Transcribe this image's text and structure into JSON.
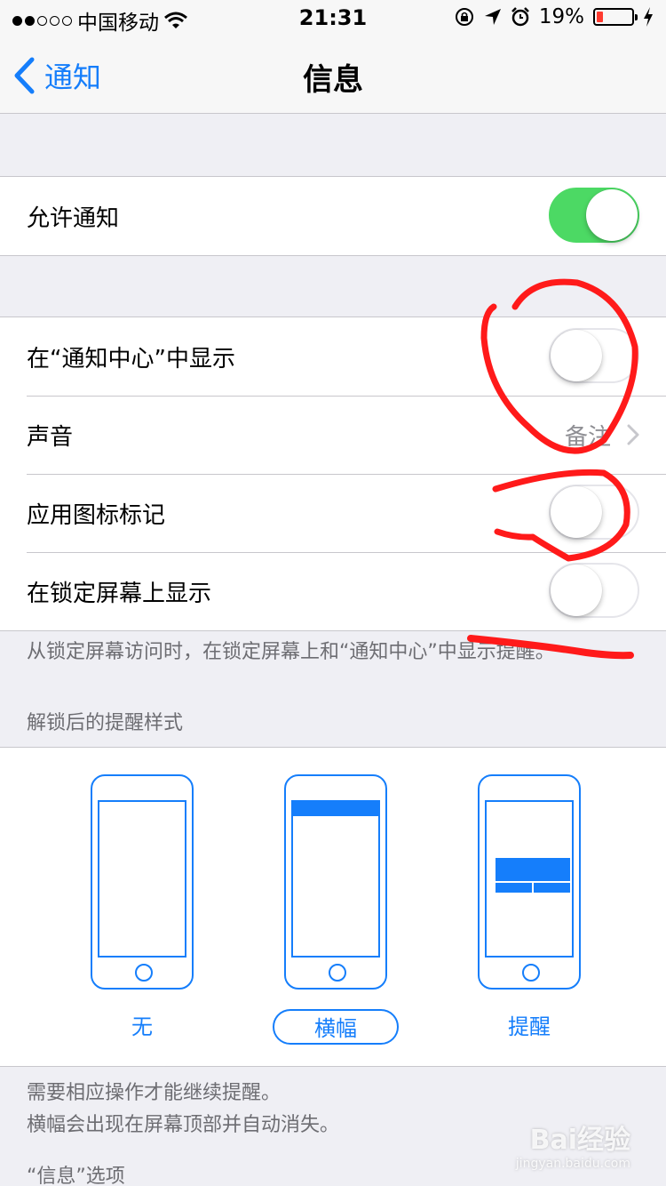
{
  "status_bar": {
    "carrier": "中国移动",
    "time": "21:31",
    "battery": "19%",
    "battery_level": 0.19,
    "icons": [
      "signal-dots",
      "wifi-icon",
      "rotation-lock-icon",
      "location-icon",
      "alarm-icon",
      "battery-icon",
      "charging-bolt-icon"
    ]
  },
  "nav": {
    "back_label": "通知",
    "title": "信息"
  },
  "allow": {
    "label": "允许通知",
    "on": true
  },
  "settings": {
    "notification_center": {
      "label": "在“通知中心”中显示",
      "on": false
    },
    "sound": {
      "label": "声音",
      "value": "备注"
    },
    "badge": {
      "label": "应用图标标记",
      "on": false
    },
    "lock_screen": {
      "label": "在锁定屏幕上显示",
      "on": false
    }
  },
  "lock_screen_footer": "从锁定屏幕访问时，在锁定屏幕上和“通知中心”中显示提醒。",
  "alert_style": {
    "header": "解锁后的提醒样式",
    "options": [
      "无",
      "横幅",
      "提醒"
    ],
    "selected": "横幅"
  },
  "alert_footer": {
    "line1": "需要相应操作才能继续提醒。",
    "line2": "横幅会出现在屏幕顶部并自动消失。"
  },
  "options_header": "“信息”选项",
  "watermark": {
    "brand": "Bai经验",
    "url": "jingyan.baidu.com"
  },
  "colors": {
    "accent": "#157efb",
    "toggle_on": "#4cd964",
    "annotation": "#ff1a1a",
    "background": "#efeff4"
  }
}
